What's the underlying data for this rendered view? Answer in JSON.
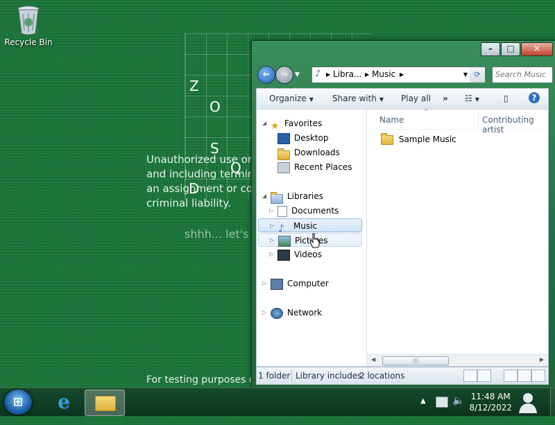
{
  "desktop": {
    "recycle_bin_label": "Recycle Bin",
    "grid_letters": [
      "Z",
      "O",
      "S",
      "Q",
      "D"
    ],
    "message_lines": [
      "Unauthorized use or c",
      "and including terminat",
      "an assignment or contr",
      "criminal liability."
    ],
    "whisper": "shhh... let's n",
    "testing_note": "For testing purposes c"
  },
  "explorer": {
    "address": {
      "segments": [
        "Libra...",
        "Music"
      ]
    },
    "search_placeholder": "Search Music",
    "toolbar": {
      "organize": "Organize",
      "share_with": "Share with",
      "play_all": "Play all",
      "more": "»"
    },
    "nav": {
      "favorites": "Favorites",
      "desktop": "Desktop",
      "downloads": "Downloads",
      "recent_places": "Recent Places",
      "libraries": "Libraries",
      "documents": "Documents",
      "music": "Music",
      "pictures": "Pictures",
      "videos": "Videos",
      "computer": "Computer",
      "network": "Network"
    },
    "columns": {
      "name": "Name",
      "contributing_artists": "Contributing artist"
    },
    "files": [
      {
        "name": "Sample Music",
        "type": "folder"
      }
    ],
    "status": {
      "count": "1 folder",
      "library_includes": "Library includes:",
      "locations": "2 locations"
    }
  },
  "taskbar": {
    "time": "11:48 AM",
    "date": "8/12/2022"
  },
  "colors": {
    "desktop_green": "#1f7a3e",
    "window_frame": "#2b7a4b",
    "selection": "#d2e4f7"
  }
}
